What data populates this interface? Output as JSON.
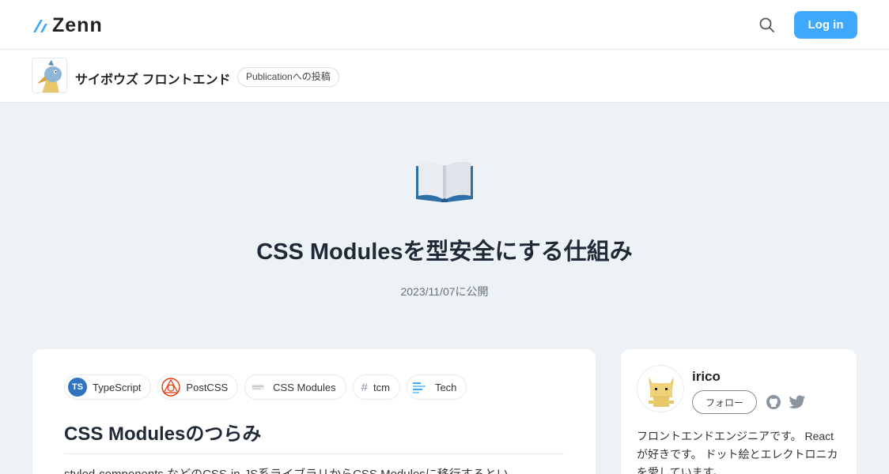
{
  "header": {
    "logo_text": "Zenn",
    "login_label": "Log in",
    "brand_color": "#3ea8ff"
  },
  "publication": {
    "name": "サイボウズ フロントエンド",
    "badge": "Publicationへの投稿"
  },
  "article": {
    "emoji": "open-book-icon",
    "title": "CSS Modulesを型安全にする仕組み",
    "published": "2023/11/07に公開",
    "tags": [
      {
        "label": "TypeScript",
        "icon": "typescript-icon",
        "icon_text": "TS"
      },
      {
        "label": "PostCSS",
        "icon": "postcss-icon"
      },
      {
        "label": "CSS Modules",
        "icon": "css-modules-icon"
      },
      {
        "label": "tcm",
        "icon": "hash-icon",
        "icon_text": "#"
      },
      {
        "label": "Tech",
        "icon": "tech-icon"
      }
    ],
    "section_heading": "CSS Modulesのつらみ",
    "body_text": "styled-components などのCSS-in-JS系ライブラリからCSS Modulesに移行するとい…"
  },
  "author": {
    "name": "irico",
    "follow_label": "フォロー",
    "bio": "フロントエンドエンジニアです。 Reactが好きです。 ドット絵とエレクトロニカを愛しています。"
  }
}
